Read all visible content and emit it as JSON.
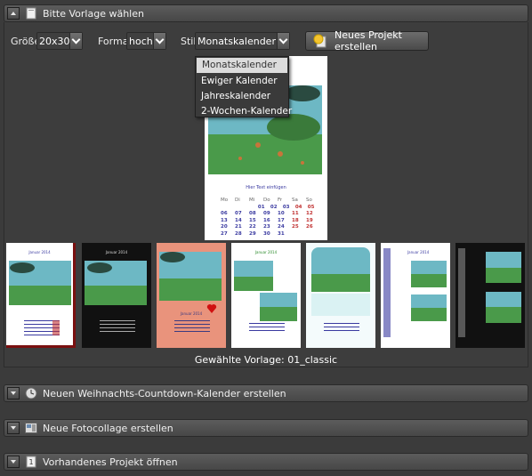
{
  "sections": {
    "template": {
      "title": "Bitte Vorlage wählen",
      "expanded": true
    },
    "countdown": {
      "title": "Neuen Weihnachts-Countdown-Kalender erstellen"
    },
    "collage": {
      "title": "Neue Fotocollage erstellen"
    },
    "open": {
      "title": "Vorhandenes Projekt öffnen"
    }
  },
  "options": {
    "size": {
      "label": "Größe:",
      "value": "20x30"
    },
    "format": {
      "label": "Format:",
      "value": "hoch"
    },
    "style": {
      "label": "Stil:",
      "value": "Monatskalender"
    },
    "new_project": {
      "label": "Neues Projekt erstellen"
    }
  },
  "style_dropdown": {
    "items": [
      "Monatskalender",
      "Ewiger Kalender",
      "Jahreskalender",
      "2-Wochen-Kalender"
    ],
    "selected": 0
  },
  "preview": {
    "text_placeholder": "Hier Text einfügen",
    "weekdays": [
      "Mo",
      "Di",
      "Mi",
      "Do",
      "Fr",
      "Sa",
      "So"
    ],
    "weeks": [
      [
        "",
        "",
        "",
        "01",
        "02",
        "03",
        "04",
        "05"
      ],
      [
        "06",
        "07",
        "08",
        "09",
        "10",
        "11",
        "12"
      ],
      [
        "13",
        "14",
        "15",
        "16",
        "17",
        "18",
        "19"
      ],
      [
        "20",
        "21",
        "22",
        "23",
        "24",
        "25",
        "26"
      ],
      [
        "27",
        "28",
        "29",
        "30",
        "31",
        "",
        ""
      ]
    ]
  },
  "thumbnails": [
    {
      "name": "01_classic",
      "title": "Januar 2014"
    },
    {
      "name": "black",
      "title": "Januar 2014"
    },
    {
      "name": "salmon",
      "title": "Januar 2014"
    },
    {
      "name": "green",
      "title": "Januar 2014"
    },
    {
      "name": "reflection",
      "title": ""
    },
    {
      "name": "list",
      "title": "Januar 2014"
    },
    {
      "name": "dark",
      "title": ""
    }
  ],
  "selected_template": {
    "label": "Gewählte Vorlage: 01_classic"
  },
  "colors": {
    "accent_blue": "#3a3aa0",
    "accent_red": "#c03030",
    "salmon": "#e9937c"
  }
}
